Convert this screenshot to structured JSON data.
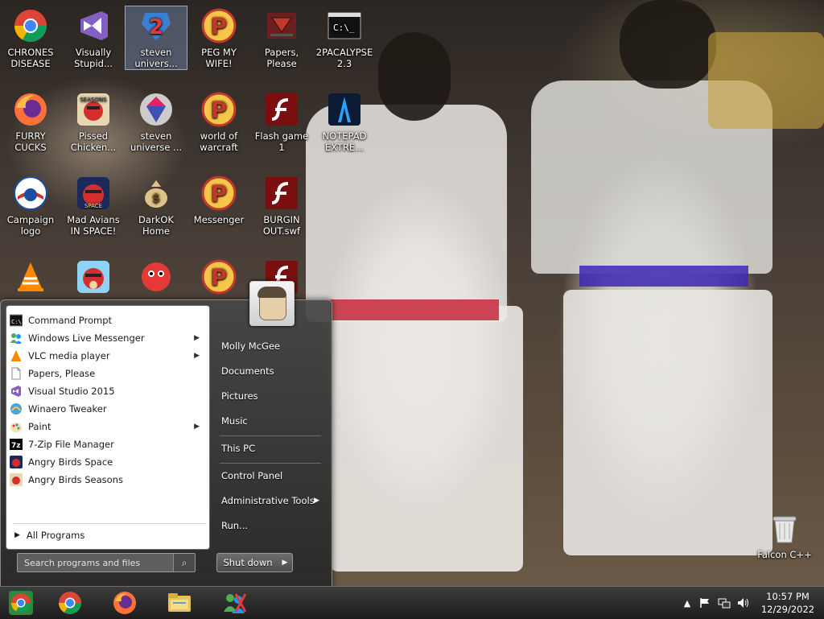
{
  "desktop": {
    "icons": [
      {
        "label": "CHRONES\nDISEASE",
        "icon": "chrome-icon"
      },
      {
        "label": "Visually\nStupid...",
        "icon": "visual-studio-icon"
      },
      {
        "label": "steven\nunivers...",
        "icon": "steven-universe-2-icon"
      },
      {
        "label": "PEG MY WIFE!",
        "icon": "pidgin-p-icon"
      },
      {
        "label": "Papers,\nPlease",
        "icon": "papers-please-icon"
      },
      {
        "label": "2PACALYPSE\n2.3",
        "icon": "command-prompt-icon"
      },
      {
        "label": "FURRY CUCKS",
        "icon": "firefox-icon"
      },
      {
        "label": "Pissed\nChicken...",
        "icon": "angry-birds-seasons-icon"
      },
      {
        "label": "steven\nuniverse ...",
        "icon": "steven-universe-gem-icon"
      },
      {
        "label": "world of\nwarcraft",
        "icon": "pidgin-p-icon"
      },
      {
        "label": "Flash game 1",
        "icon": "flash-icon"
      },
      {
        "label": "NOTEPAD\nEXTRE...",
        "icon": "notepad-extreme-icon"
      },
      {
        "label": "Campaign logo",
        "icon": "obama-logo-icon"
      },
      {
        "label": "Mad Avians\nIN SPACE!",
        "icon": "angry-birds-space-icon"
      },
      {
        "label": "DarkOK Home",
        "icon": "money-bag-icon"
      },
      {
        "label": "Messenger",
        "icon": "pidgin-p-icon"
      },
      {
        "label": "BURGIN\nOUT.swf",
        "icon": "flash-icon"
      },
      {
        "label": "",
        "icon": "vlc-icon"
      },
      {
        "label": "",
        "icon": "angry-birds-icon"
      },
      {
        "label": "",
        "icon": "red-fuzzball-icon"
      },
      {
        "label": "",
        "icon": "pidgin-p-icon"
      },
      {
        "label": "",
        "icon": "flash-icon"
      },
      {
        "label": "Falcon C++",
        "icon": "recycle-bin-icon"
      }
    ]
  },
  "start_menu": {
    "programs": [
      {
        "label": "Command Prompt",
        "icon": "command-prompt-icon",
        "submenu": false
      },
      {
        "label": "Windows Live Messenger",
        "icon": "messenger-icon",
        "submenu": true
      },
      {
        "label": "VLC media player",
        "icon": "vlc-icon",
        "submenu": true
      },
      {
        "label": "Papers, Please",
        "icon": "document-icon",
        "submenu": false
      },
      {
        "label": "Visual Studio 2015",
        "icon": "visual-studio-icon",
        "submenu": false
      },
      {
        "label": "Winaero Tweaker",
        "icon": "winaero-icon",
        "submenu": false
      },
      {
        "label": "Paint",
        "icon": "paint-icon",
        "submenu": true
      },
      {
        "label": "7-Zip File Manager",
        "icon": "7zip-icon",
        "submenu": false
      },
      {
        "label": "Angry Birds Space",
        "icon": "angry-birds-space-icon",
        "submenu": false
      },
      {
        "label": "Angry Birds Seasons",
        "icon": "angry-birds-seasons-icon",
        "submenu": false
      }
    ],
    "all_programs": "All Programs",
    "search_placeholder": "Search programs and files",
    "right": {
      "user": "Molly McGee",
      "documents": "Documents",
      "pictures": "Pictures",
      "music": "Music",
      "this_pc": "This PC",
      "control_panel": "Control Panel",
      "admin_tools": "Administrative Tools",
      "run": "Run...",
      "shutdown": "Shut down"
    }
  },
  "taskbar": {
    "pinned": [
      "chrome-orb-icon",
      "chrome-icon",
      "firefox-icon",
      "file-explorer-icon",
      "messenger-icon"
    ],
    "time": "10:57 PM",
    "date": "12/29/2022"
  }
}
